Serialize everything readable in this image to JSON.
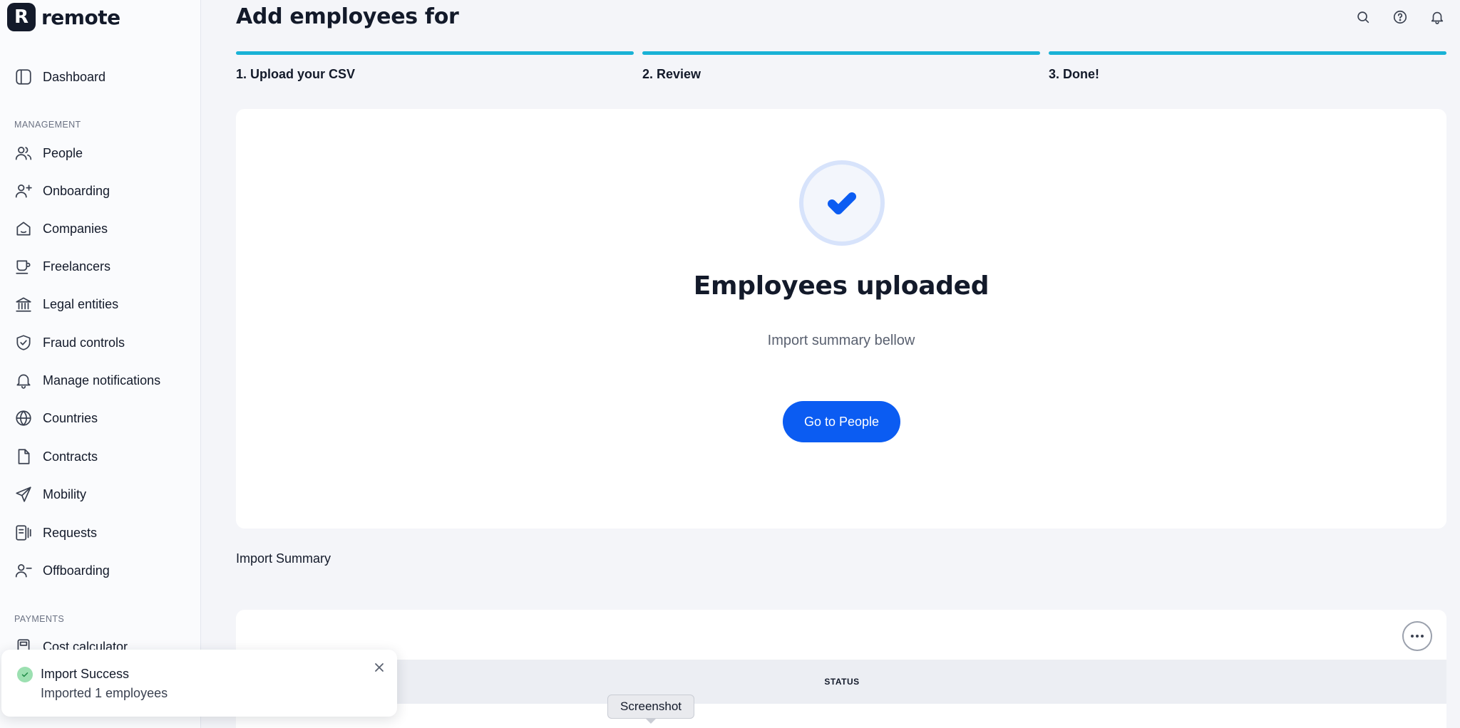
{
  "brand": {
    "mark": "R",
    "name": "remote"
  },
  "sidebar": {
    "dashboard": "Dashboard",
    "management_label": "MANAGEMENT",
    "management_items": [
      {
        "label": "People",
        "icon": "people-icon"
      },
      {
        "label": "Onboarding",
        "icon": "user-plus-icon"
      },
      {
        "label": "Companies",
        "icon": "company-icon"
      },
      {
        "label": "Freelancers",
        "icon": "cup-icon"
      },
      {
        "label": "Legal entities",
        "icon": "bank-icon"
      },
      {
        "label": "Fraud controls",
        "icon": "shield-check-icon"
      },
      {
        "label": "Manage notifications",
        "icon": "bell-icon"
      },
      {
        "label": "Countries",
        "icon": "globe-icon"
      },
      {
        "label": "Contracts",
        "icon": "document-icon"
      },
      {
        "label": "Mobility",
        "icon": "paper-plane-icon"
      },
      {
        "label": "Requests",
        "icon": "requests-icon"
      },
      {
        "label": "Offboarding",
        "icon": "user-minus-icon"
      }
    ],
    "payments_label": "PAYMENTS",
    "payments_items": [
      {
        "label": "Cost calculator",
        "icon": "calculator-icon"
      }
    ]
  },
  "header": {
    "title": "Add employees for"
  },
  "steps": [
    {
      "label": "1. Upload your CSV"
    },
    {
      "label": "2. Review"
    },
    {
      "label": "3. Done!"
    }
  ],
  "success": {
    "title": "Employees uploaded",
    "subtitle": "Import summary bellow",
    "button": "Go to People"
  },
  "summary": {
    "title": "Import Summary",
    "status_header": "STATUS"
  },
  "toast": {
    "title": "Import Success",
    "body": "Imported 1 employees"
  },
  "tooltip": "Screenshot",
  "colors": {
    "accent": "#0b5cf2",
    "step_bar": "#19b2d6",
    "success": "#9ce0b1"
  }
}
